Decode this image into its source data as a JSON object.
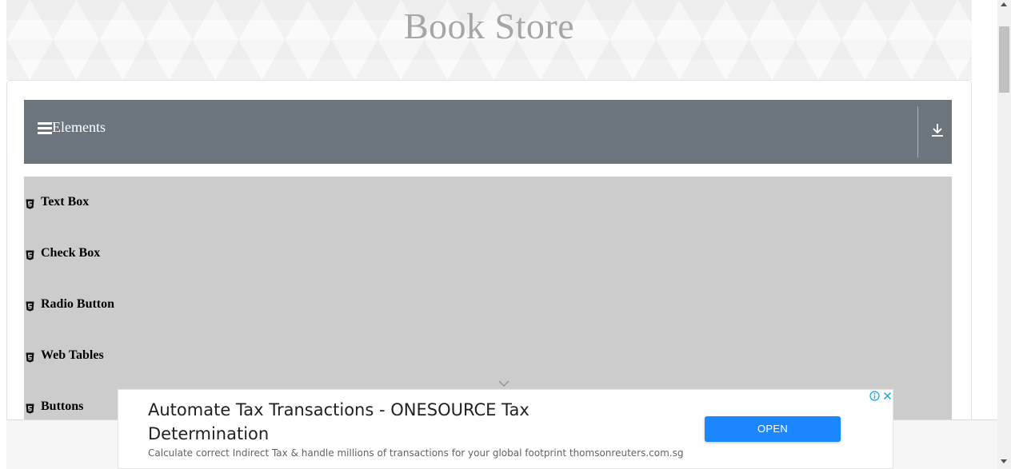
{
  "header": {
    "title": "Book Store"
  },
  "group": {
    "title": "Elements",
    "items": [
      {
        "label": "Text Box"
      },
      {
        "label": "Check Box"
      },
      {
        "label": "Radio Button"
      },
      {
        "label": "Web Tables"
      },
      {
        "label": "Buttons"
      }
    ]
  },
  "ad": {
    "title": "Automate Tax Transactions - ONESOURCE Tax Determination",
    "description": "Calculate correct Indirect Tax & handle millions of transactions for your global footprint thomsonreuters.com.sg",
    "button_label": "OPEN"
  },
  "colors": {
    "group_header": "#6c747c",
    "menu_background": "#cccccc",
    "ad_button": "#1a86ff",
    "title_text": "#a6a6a6"
  },
  "icons": [
    "hamburger-icon",
    "download-icon",
    "html5-icon",
    "chevron-down-icon",
    "info-icon",
    "close-icon"
  ]
}
